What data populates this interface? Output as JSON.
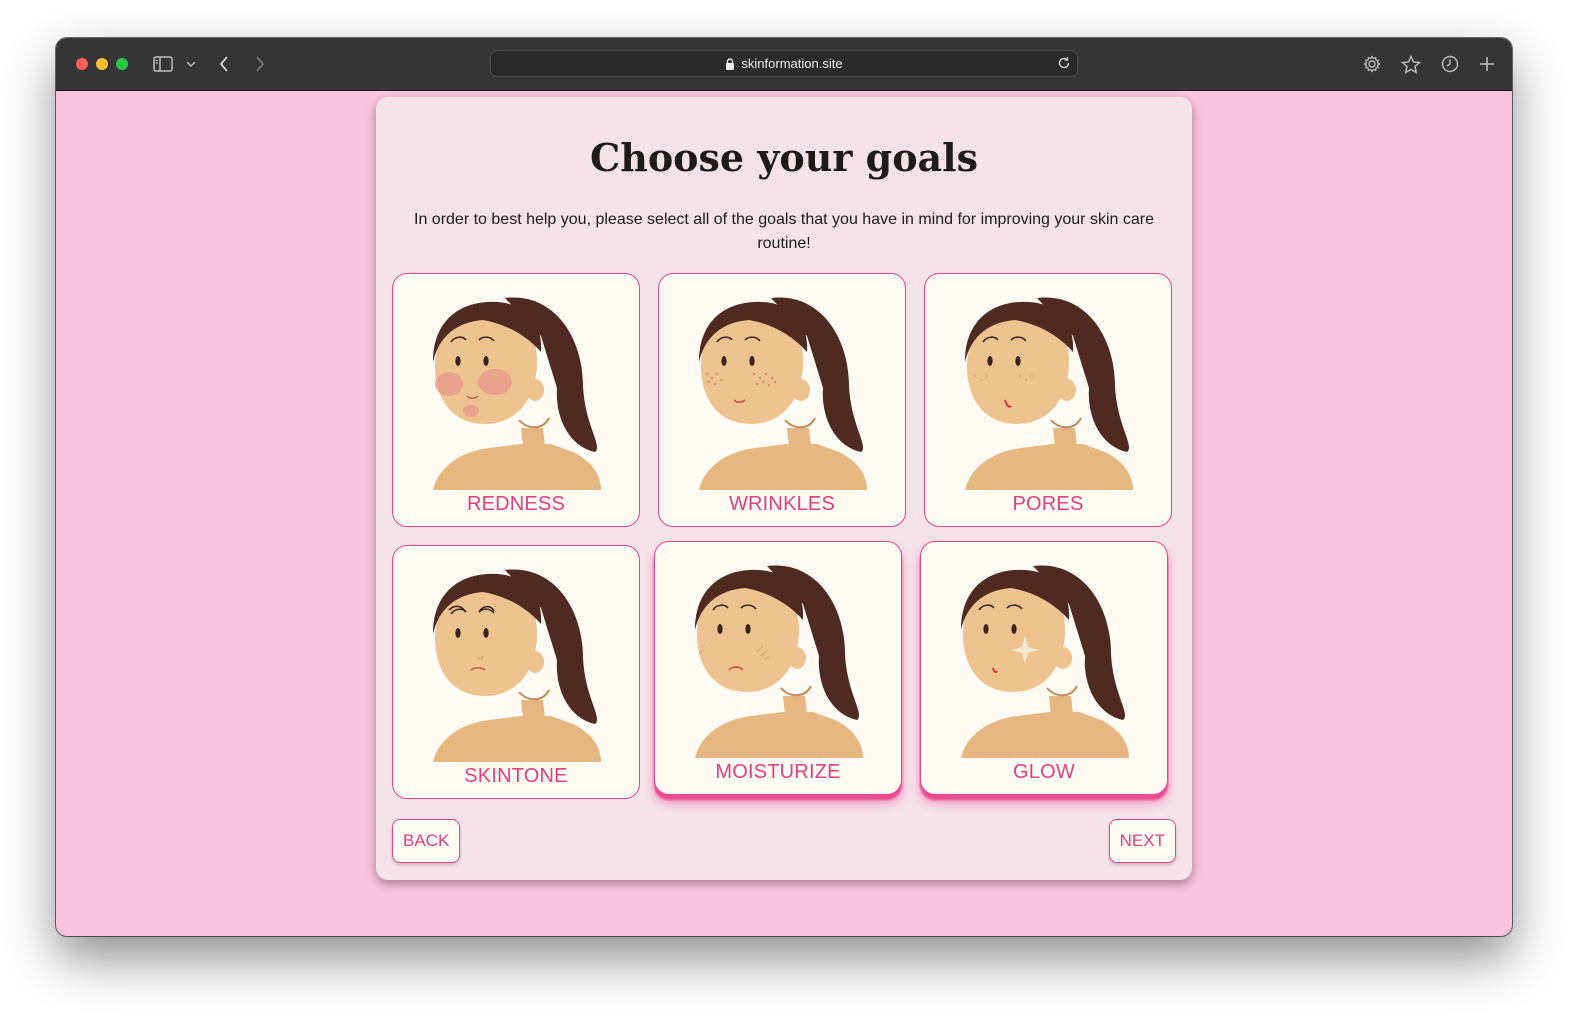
{
  "browser": {
    "url": "skinformation.site"
  },
  "page": {
    "title": "Choose your goals",
    "subtitle": "In order to best help you, please select all of the goals that you have in mind for improving your skin care routine!",
    "back_label": "BACK",
    "next_label": "NEXT"
  },
  "goals": [
    {
      "label": "REDNESS",
      "selected": false
    },
    {
      "label": "WRINKLES",
      "selected": false
    },
    {
      "label": "PORES",
      "selected": false
    },
    {
      "label": "SKINTONE",
      "selected": false
    },
    {
      "label": "MOISTURIZE",
      "selected": true
    },
    {
      "label": "GLOW",
      "selected": true
    }
  ],
  "colors": {
    "background": "#fbc4dc",
    "card": "#f6e3ea",
    "accent": "#e0417f",
    "tile": "#fdfbf3",
    "hair": "#4f2a20",
    "skin": "#efc38f"
  }
}
